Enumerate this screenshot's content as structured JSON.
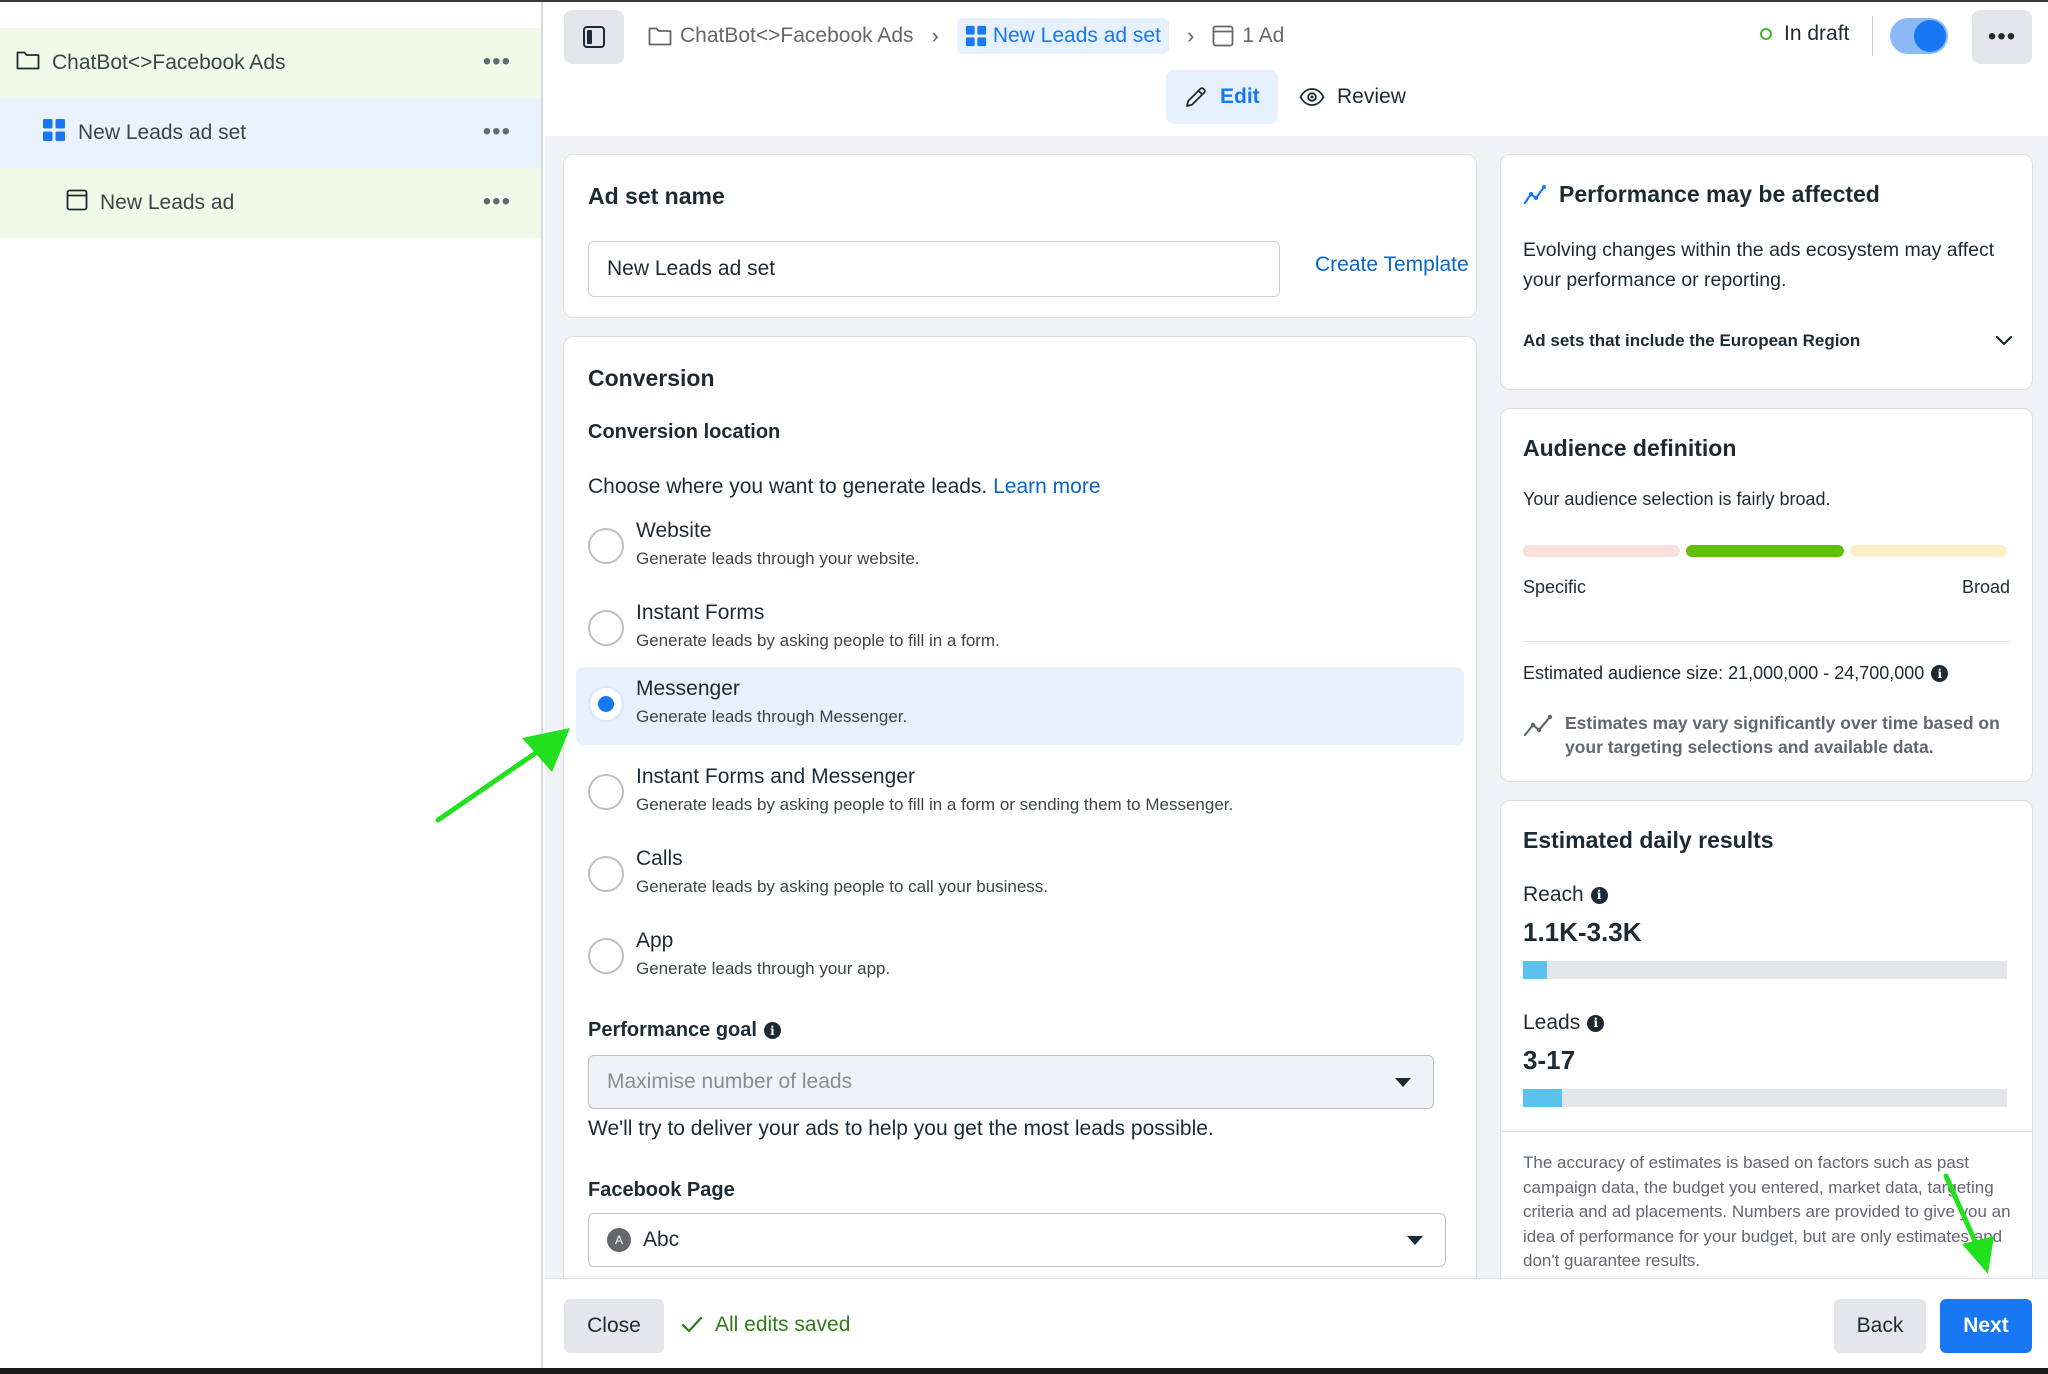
{
  "tree": {
    "campaign": "ChatBot<>Facebook Ads",
    "adset": "New Leads ad set",
    "ad": "New Leads ad",
    "more": "•••"
  },
  "header": {
    "breadcrumb": [
      "ChatBot<>Facebook Ads",
      "New Leads ad set",
      "1 Ad"
    ],
    "status": "In draft",
    "tabs": {
      "edit": "Edit",
      "review": "Review"
    },
    "more": "•••"
  },
  "adset_name": {
    "title": "Ad set name",
    "value": "New Leads ad set",
    "create_template": "Create Template"
  },
  "conversion": {
    "title": "Conversion",
    "location_title": "Conversion location",
    "choose_text": "Choose where you want to generate leads.",
    "learn_more": "Learn more",
    "options": [
      {
        "title": "Website",
        "desc": "Generate leads through your website."
      },
      {
        "title": "Instant Forms",
        "desc": "Generate leads by asking people to fill in a form."
      },
      {
        "title": "Messenger",
        "desc": "Generate leads through Messenger."
      },
      {
        "title": "Instant Forms and Messenger",
        "desc": "Generate leads by asking people to fill in a form or sending them to Messenger."
      },
      {
        "title": "Calls",
        "desc": "Generate leads by asking people to call your business."
      },
      {
        "title": "App",
        "desc": "Generate leads through your app."
      }
    ],
    "selected": "Messenger",
    "performance_goal_label": "Performance goal",
    "performance_goal_value": "Maximise number of leads",
    "performance_help": "We'll try to deliver your ads to help you get the most leads possible.",
    "facebook_page_label": "Facebook Page",
    "facebook_page_value": "Abc",
    "facebook_page_avatar": "A"
  },
  "performance": {
    "title": "Performance may be affected",
    "body": "Evolving changes within the ads ecosystem may affect your performance or reporting.",
    "accordion": "Ad sets that include the European Region"
  },
  "audience": {
    "title": "Audience definition",
    "desc": "Your audience selection is fairly broad.",
    "left_label": "Specific",
    "right_label": "Broad",
    "size_label": "Estimated audience size:",
    "size_value": "21,000,000 - 24,700,000",
    "note": "Estimates may vary significantly over time based on your targeting selections and available data.",
    "colors": {
      "specific": "#fbe0dd",
      "middle": "#63be09",
      "broad": "#fdefc7"
    }
  },
  "estimates": {
    "title": "Estimated daily results",
    "reach_label": "Reach",
    "reach_value": "1.1K-3.3K",
    "reach_fill": 0.05,
    "leads_label": "Leads",
    "leads_value": "3-17",
    "leads_fill": 0.08,
    "note": "The accuracy of estimates is based on factors such as past campaign data, the budget you entered, market data, targeting criteria and ad placements. Numbers are provided to give you an idea of performance for your budget, but are only estimates and don't guarantee results."
  },
  "footer": {
    "close": "Close",
    "saved": "All edits saved",
    "back": "Back",
    "next": "Next"
  },
  "colors": {
    "accent": "#1877f2",
    "annotation_arrow": "#22e01e"
  }
}
